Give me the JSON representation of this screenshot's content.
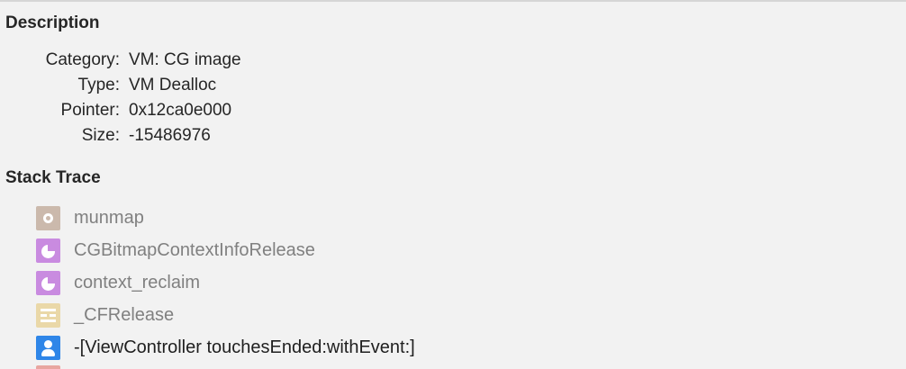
{
  "description": {
    "title": "Description",
    "fields": [
      {
        "label": "Category:",
        "value": "VM: CG image"
      },
      {
        "label": "Type:",
        "value": "VM Dealloc"
      },
      {
        "label": "Pointer:",
        "value": "0x12ca0e000"
      },
      {
        "label": "Size:",
        "value": "-15486976"
      }
    ]
  },
  "stack_trace": {
    "title": "Stack Trace",
    "frames": [
      {
        "label": "munmap",
        "icon": "gear-icon",
        "color": "#cbb9ac",
        "style": "system"
      },
      {
        "label": "CGBitmapContextInfoRelease",
        "icon": "pie-chart-icon",
        "color": "#c98be0",
        "style": "system"
      },
      {
        "label": "context_reclaim",
        "icon": "pie-chart-icon",
        "color": "#c98be0",
        "style": "system"
      },
      {
        "label": "_CFRelease",
        "icon": "corefoundation-icon",
        "color": "#ead8a8",
        "style": "system"
      },
      {
        "label": "-[ViewController touchesEnded:withEvent:]",
        "icon": "user-icon",
        "color": "#2f86e8",
        "style": "user"
      }
    ]
  }
}
